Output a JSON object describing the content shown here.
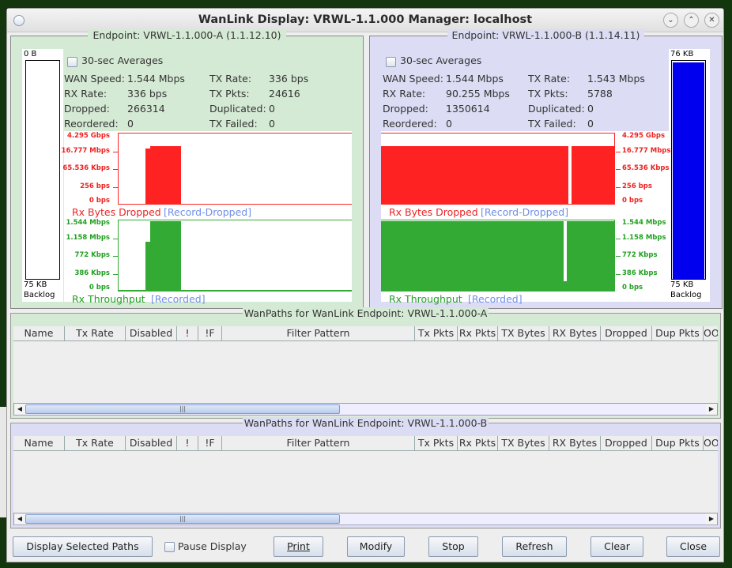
{
  "window": {
    "title": "WanLink Display: VRWL-1.1.000  Manager: localhost",
    "minimize_icon": "chevron-down-icon",
    "maximize_icon": "chevron-up-icon",
    "close_icon": "close-icon"
  },
  "endpoints": [
    {
      "title": "Endpoint: VRWL-1.1.000-A  (1.1.12.10)",
      "bg": "#d5ead5",
      "avg_label": "30-sec Averages",
      "stats": {
        "wan_speed_label": "WAN Speed:",
        "wan_speed": "1.544 Mbps",
        "rx_rate_label": "RX Rate:",
        "rx_rate": "336 bps",
        "dropped_label": "Dropped:",
        "dropped": "266314",
        "reordered_label": "Reordered:",
        "reordered": "0",
        "tx_rate_label": "TX Rate:",
        "tx_rate": "336 bps",
        "tx_pkts_label": "TX Pkts:",
        "tx_pkts": "24616",
        "duplicated_label": "Duplicated:",
        "duplicated": "0",
        "tx_failed_label": "TX Failed:",
        "tx_failed": "0"
      },
      "backlog": {
        "top": "0 B",
        "bottom": "75 KB",
        "label": "Backlog",
        "fill": 0
      }
    },
    {
      "title": "Endpoint: VRWL-1.1.000-B  (1.1.14.11)",
      "bg": "#dcdcf4",
      "avg_label": "30-sec Averages",
      "stats": {
        "wan_speed_label": "WAN Speed:",
        "wan_speed": "1.544 Mbps",
        "rx_rate_label": "RX Rate:",
        "rx_rate": "90.255 Mbps",
        "dropped_label": "Dropped:",
        "dropped": "1350614",
        "reordered_label": "Reordered:",
        "reordered": "0",
        "tx_rate_label": "TX Rate:",
        "tx_rate": "1.543 Mbps",
        "tx_pkts_label": "TX Pkts:",
        "tx_pkts": "5788",
        "duplicated_label": "Duplicated:",
        "duplicated": "0",
        "tx_failed_label": "TX Failed:",
        "tx_failed": "0"
      },
      "backlog": {
        "top": "76 KB",
        "bottom": "75 KB",
        "label": "Backlog",
        "fill": 1
      }
    }
  ],
  "chart_data": [
    {
      "type": "area",
      "endpoint": "A",
      "title": "Rx Bytes Dropped",
      "link": "[Record-Dropped]",
      "color": "#ff2222",
      "yticks": [
        "4.295 Gbps",
        "16.777 Mbps",
        "65.536 Kbps",
        "256 bps",
        "0 bps"
      ],
      "segments": [
        {
          "from": 0.115,
          "to": 0.135,
          "level": 0.78
        },
        {
          "from": 0.135,
          "to": 0.268,
          "level": 0.81
        }
      ]
    },
    {
      "type": "area",
      "endpoint": "A",
      "title": "Rx Throughput",
      "link": "[Recorded]",
      "color": "#33aa33",
      "yticks": [
        "1.544 Mbps",
        "1.158 Mbps",
        "772 Kbps",
        "386 Kbps",
        "0 bps"
      ],
      "segments": [
        {
          "from": 0,
          "to": 1,
          "level": 0.02
        },
        {
          "from": 0.115,
          "to": 0.135,
          "level": 0.7
        },
        {
          "from": 0.135,
          "to": 0.268,
          "level": 0.99
        }
      ]
    },
    {
      "type": "area",
      "endpoint": "B",
      "title": "Rx Bytes Dropped",
      "link": "[Record-Dropped]",
      "color": "#ff2222",
      "yticks": [
        "4.295 Gbps",
        "16.777 Mbps",
        "65.536 Kbps",
        "256 bps",
        "0 bps"
      ],
      "segments": [
        {
          "from": 0,
          "to": 0.8,
          "level": 0.81
        },
        {
          "from": 0.815,
          "to": 1,
          "level": 0.81
        }
      ]
    },
    {
      "type": "area",
      "endpoint": "B",
      "title": "Rx Throughput",
      "link": "[Recorded]",
      "color": "#33aa33",
      "yticks": [
        "1.544 Mbps",
        "1.158 Mbps",
        "772 Kbps",
        "386 Kbps",
        "0 bps"
      ],
      "segments": [
        {
          "from": 0,
          "to": 0.78,
          "level": 0.99
        },
        {
          "from": 0.78,
          "to": 0.795,
          "level": 0.14
        },
        {
          "from": 0.795,
          "to": 1,
          "level": 0.99
        }
      ]
    }
  ],
  "tables": [
    {
      "title": "WanPaths for WanLink Endpoint: VRWL-1.1.000-A"
    },
    {
      "title": "WanPaths for WanLink Endpoint: VRWL-1.1.000-B"
    }
  ],
  "columns": [
    "Name",
    "Tx Rate",
    "Disabled",
    "!",
    "!F",
    "Filter Pattern",
    "Tx Pkts",
    "Rx Pkts",
    "TX Bytes",
    "RX Bytes",
    "Dropped",
    "Dup Pkts",
    "OO"
  ],
  "buttons": {
    "display_selected": "Display Selected Paths",
    "pause": "Pause Display",
    "print": "Print",
    "modify": "Modify",
    "stop": "Stop",
    "refresh": "Refresh",
    "clear": "Clear",
    "close": "Close"
  }
}
